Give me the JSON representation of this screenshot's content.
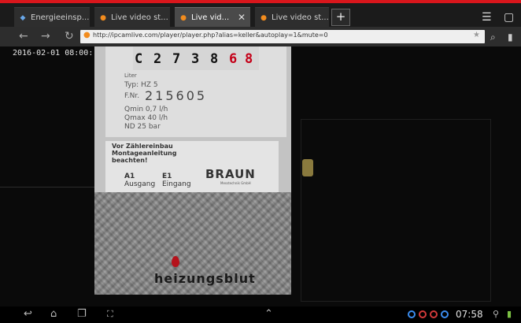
{
  "colors": {
    "accent": "#d9161c",
    "favicon": "#f28c1e",
    "status_blue": "#3b8df0",
    "status_red": "#d23a3a"
  },
  "tabs": [
    {
      "label": "Energieeinsp...",
      "active": false,
      "icon": "blue-favicon"
    },
    {
      "label": "Live video st...",
      "active": false,
      "icon": "orange-favicon"
    },
    {
      "label": "Live vid...",
      "active": true,
      "icon": "orange-favicon"
    },
    {
      "label": "Live video st...",
      "active": false,
      "icon": "orange-favicon"
    }
  ],
  "tabbar": {
    "new_tab": "+",
    "close": "✕"
  },
  "address": {
    "url": "http://ipcamlive.com/player/player.php?alias=keller&autoplay=1&mute=0"
  },
  "video": {
    "timestamp": "2016-02-01 08:00:",
    "dial_digits": [
      "C",
      "2",
      "7",
      "3",
      "8",
      "6",
      "8"
    ],
    "plate": {
      "unit": "Liter",
      "type": "Typ: HZ 5",
      "fnr_label": "F.Nr.",
      "fnr": "215605",
      "qmin": "Qmin 0,7 l/h",
      "qmax": "Qmax 40 l/h",
      "nd": "ND 25 bar"
    },
    "warning": [
      "Vor Zählereinbau",
      "Montageanleitung",
      "beachten!"
    ],
    "port_a": {
      "code": "A1",
      "label": "Ausgang"
    },
    "port_e": {
      "code": "E1",
      "label": "Eingang"
    },
    "brand": "BRAUN",
    "brand_sub": "Messtechnik GmbH",
    "watermark": "heizungsblut"
  },
  "status": {
    "time": "07:58"
  }
}
